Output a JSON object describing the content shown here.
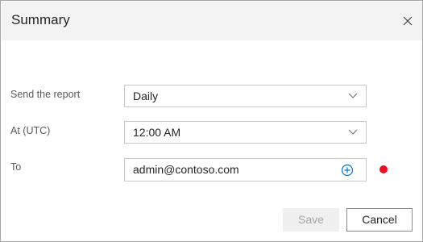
{
  "dialog": {
    "title": "Summary"
  },
  "form": {
    "frequency": {
      "label": "Send the report",
      "value": "Daily"
    },
    "time": {
      "label": "At (UTC)",
      "value": "12:00 AM"
    },
    "recipients": {
      "label": "To",
      "value": "admin@contoso.com"
    }
  },
  "actions": {
    "save_label": "Save",
    "cancel_label": "Cancel"
  },
  "colors": {
    "required_indicator": "#e81123",
    "add_icon": "#0078d4",
    "header_bg": "#f3f3f3"
  },
  "icons": {
    "close": "close-icon",
    "dropdown": "chevron-down-icon",
    "add": "add-circle-icon"
  }
}
